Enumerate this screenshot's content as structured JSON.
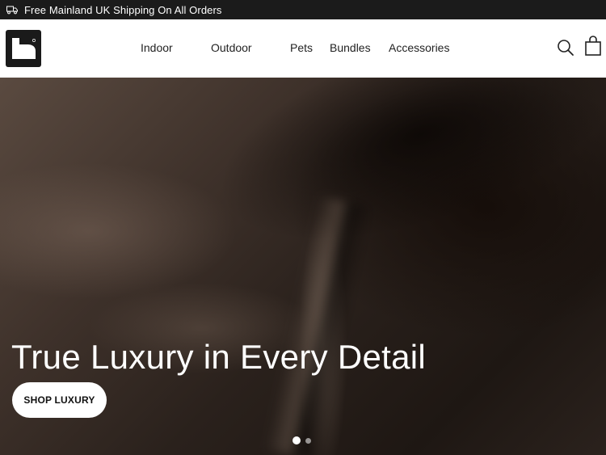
{
  "announcement": {
    "icon": "truck-icon",
    "text": "Free Mainland UK Shipping On All Orders"
  },
  "header": {
    "logo": "brand-logo",
    "nav": [
      {
        "label": "Indoor"
      },
      {
        "label": "Outdoor"
      },
      {
        "label": "Pets"
      },
      {
        "label": "Bundles"
      },
      {
        "label": "Accessories"
      }
    ],
    "icons": [
      "search-icon",
      "shopping-bag-icon"
    ]
  },
  "hero": {
    "title": "True Luxury in Every Detail",
    "cta": "SHOP LUXURY",
    "slides_total": 2,
    "active_slide": 1
  },
  "colors": {
    "topbar": "#1b1b1b",
    "hero_dark": "#2a211c",
    "button": "#ffffff"
  }
}
